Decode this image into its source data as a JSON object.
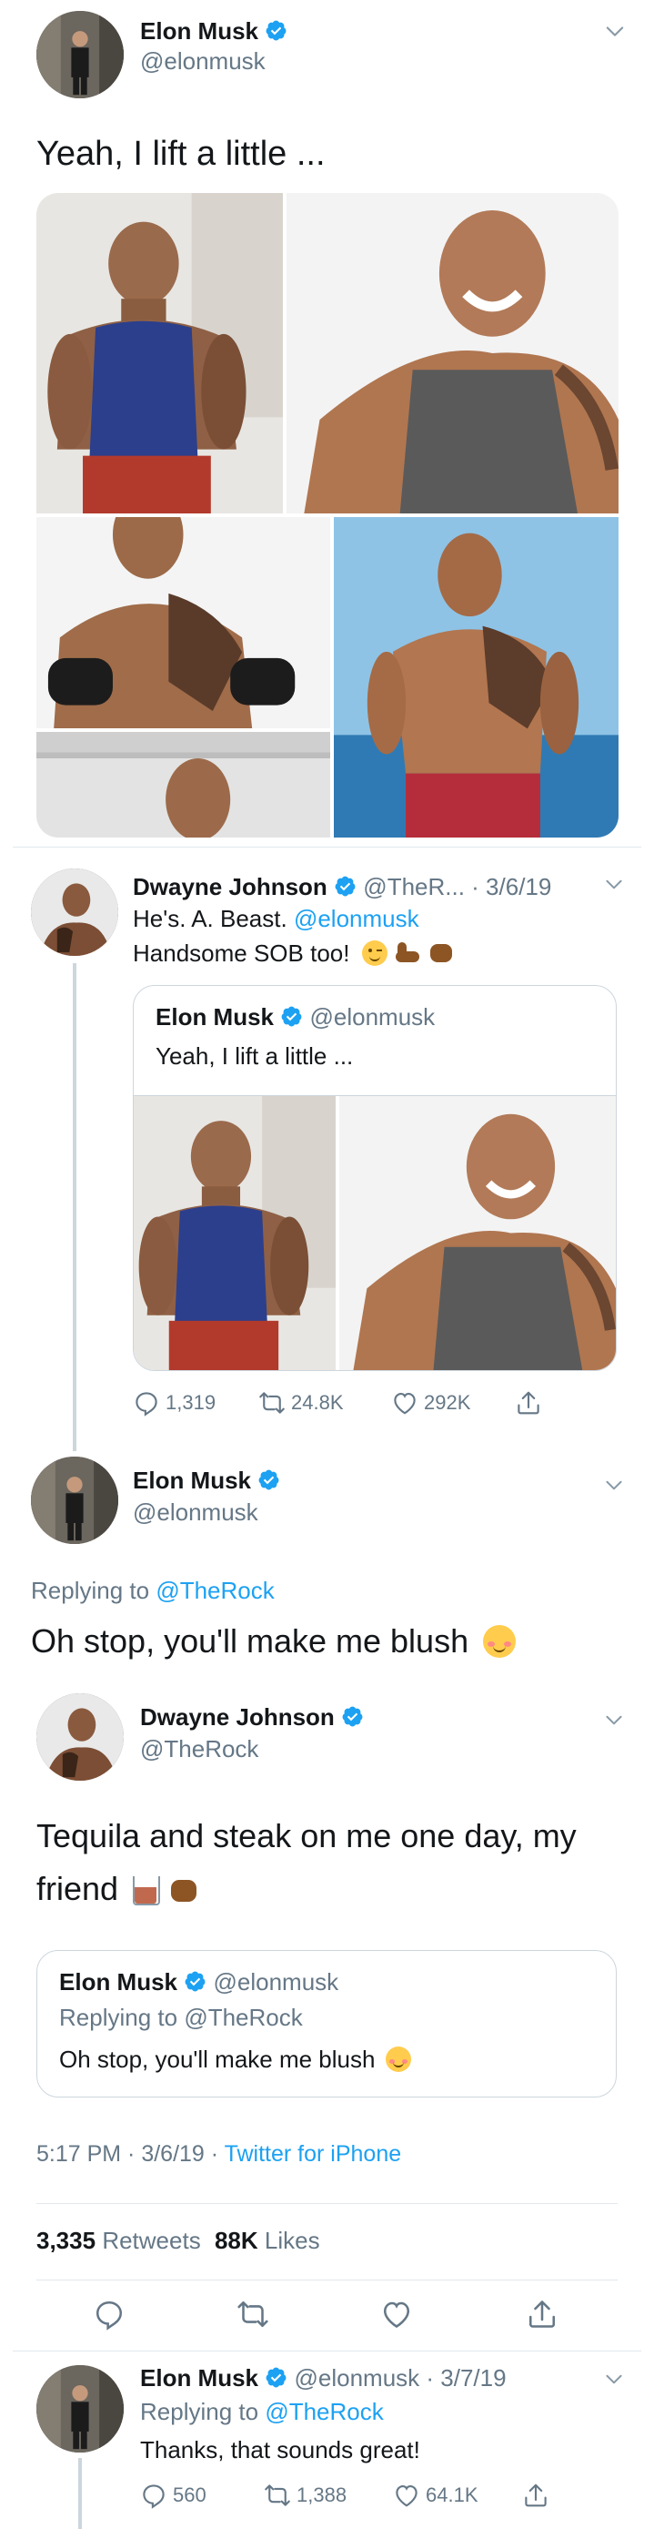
{
  "tweet1": {
    "name": "Elon Musk",
    "handle": "@elonmusk",
    "text": "Yeah, I lift a little ..."
  },
  "reply1": {
    "name": "Dwayne Johnson",
    "handle_date": "@TheR... · 3/6/19",
    "line1_prefix": "He's. A. Beast. ",
    "line1_link": "@elonmusk",
    "line2": "Handsome SOB too!",
    "quote": {
      "name": "Elon Musk",
      "handle": "@elonmusk",
      "text": "Yeah, I lift a little ..."
    },
    "actions": {
      "replies": "1,319",
      "retweets": "24.8K",
      "likes": "292K"
    }
  },
  "reply2": {
    "name": "Elon Musk",
    "handle": "@elonmusk",
    "replying_prefix": "Replying to ",
    "replying_link": "@TheRock",
    "text": "Oh stop, you'll make me blush"
  },
  "main": {
    "name": "Dwayne Johnson",
    "handle": "@TheRock",
    "text_line1": "Tequila and steak on me one day, my",
    "text_line2": "friend",
    "quote": {
      "name": "Elon Musk",
      "handle": "@elonmusk",
      "replying_prefix": "Replying to ",
      "replying_link": "@TheRock",
      "text": "Oh stop, you'll make me blush"
    },
    "time_date": "5:17 PM · 3/6/19 · ",
    "source": "Twitter for iPhone",
    "retweets_count": "3,335",
    "retweets_label": "Retweets",
    "likes_count": "88K",
    "likes_label": "Likes"
  },
  "reply3": {
    "name": "Elon Musk",
    "handle_date": "@elonmusk · 3/7/19",
    "replying_prefix": "Replying to ",
    "replying_link": "@TheRock",
    "text": "Thanks, that sounds great!",
    "actions": {
      "replies": "560",
      "retweets": "1,388",
      "likes": "64.1K"
    }
  },
  "colors": {
    "link": "#1da1f2",
    "muted": "#657786",
    "divider": "#e1e8ed",
    "verified": "#1da1f2"
  }
}
